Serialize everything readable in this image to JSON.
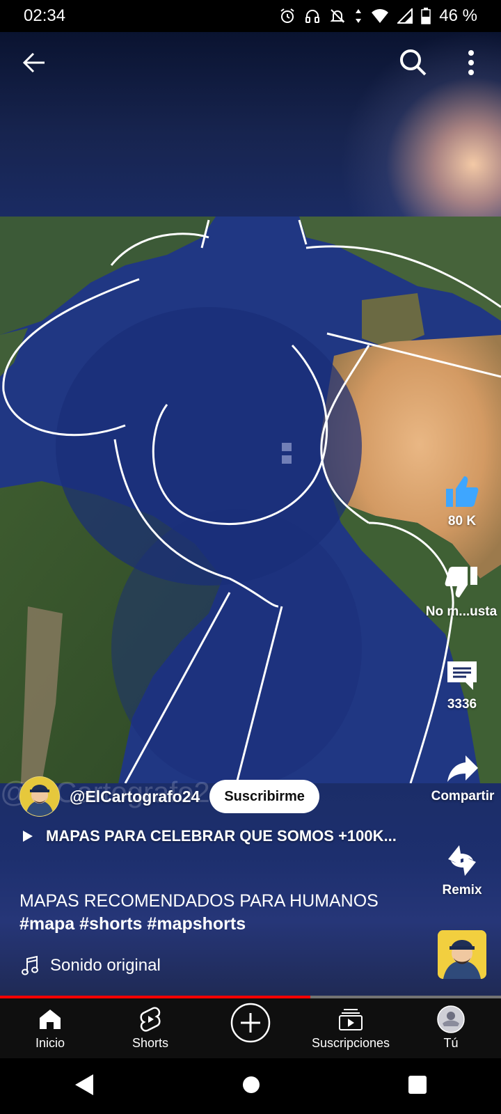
{
  "status_bar": {
    "time": "02:34",
    "battery": "46 %",
    "icons": [
      "alarm-icon",
      "headphones-icon",
      "bell-off-icon",
      "data-arrows-icon",
      "wifi-icon",
      "signal-icon",
      "battery-icon"
    ]
  },
  "top_bar": {
    "icons": [
      "back-arrow-icon",
      "search-icon",
      "more-vert-icon"
    ]
  },
  "actions": {
    "like_count": "80 K",
    "dislike_label": "No m...usta",
    "comments_count": "3336",
    "share_label": "Compartir",
    "remix_label": "Remix"
  },
  "channel": {
    "handle": "@ElCartografo24",
    "subscribe_label": "Suscribirme",
    "watermark": "@ElCartografo24"
  },
  "playlist": {
    "title": "MAPAS PARA CELEBRAR QUE SOMOS +100K..."
  },
  "description": {
    "title": "MAPAS RECOMENDADOS PARA HUMANOS",
    "hashtags": "#mapa #shorts #mapshorts"
  },
  "sound": {
    "label": "Sonido original"
  },
  "progress": {
    "fraction": 0.62,
    "fill_color": "#ff0000"
  },
  "nav": {
    "items": [
      {
        "label": "Inicio",
        "icon": "home-icon"
      },
      {
        "label": "Shorts",
        "icon": "shorts-icon"
      },
      {
        "label": "",
        "icon": "create-plus-icon"
      },
      {
        "label": "Suscripciones",
        "icon": "subscriptions-icon"
      },
      {
        "label": "Tú",
        "icon": "profile-avatar"
      }
    ]
  }
}
